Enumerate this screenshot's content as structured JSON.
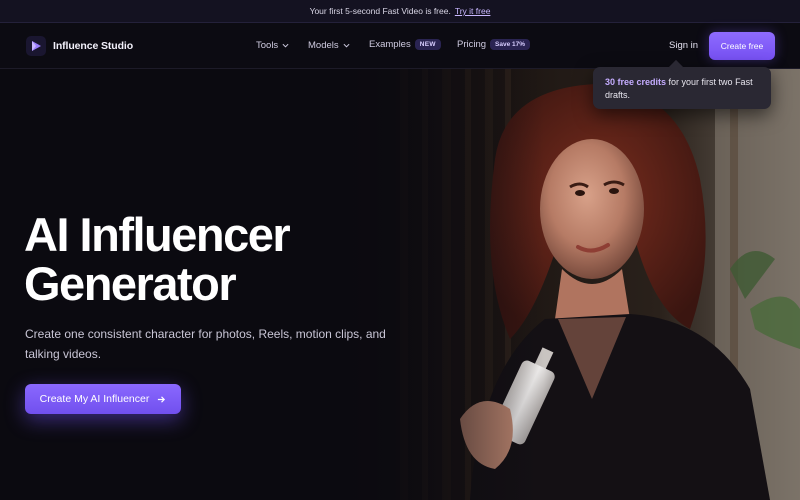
{
  "announcement": {
    "text": "Your first 5-second Fast Video is free.",
    "link": "Try it free"
  },
  "brand": {
    "name": "Influence Studio",
    "accent": "#7c5cff"
  },
  "nav": {
    "tools": "Tools",
    "models": "Models",
    "examples": "Examples",
    "examples_badge": "NEW",
    "pricing": "Pricing",
    "pricing_badge": "Save 17%",
    "signin": "Sign in",
    "create": "Create free"
  },
  "tooltip": {
    "highlight": "30 free credits",
    "text": " for your first two Fast drafts."
  },
  "hero": {
    "title_line1": "AI Influencer",
    "title_line2": "Generator",
    "subtitle": "Create one consistent character for photos, Reels, motion clips, and talking videos.",
    "cta": "Create My AI Influencer"
  }
}
